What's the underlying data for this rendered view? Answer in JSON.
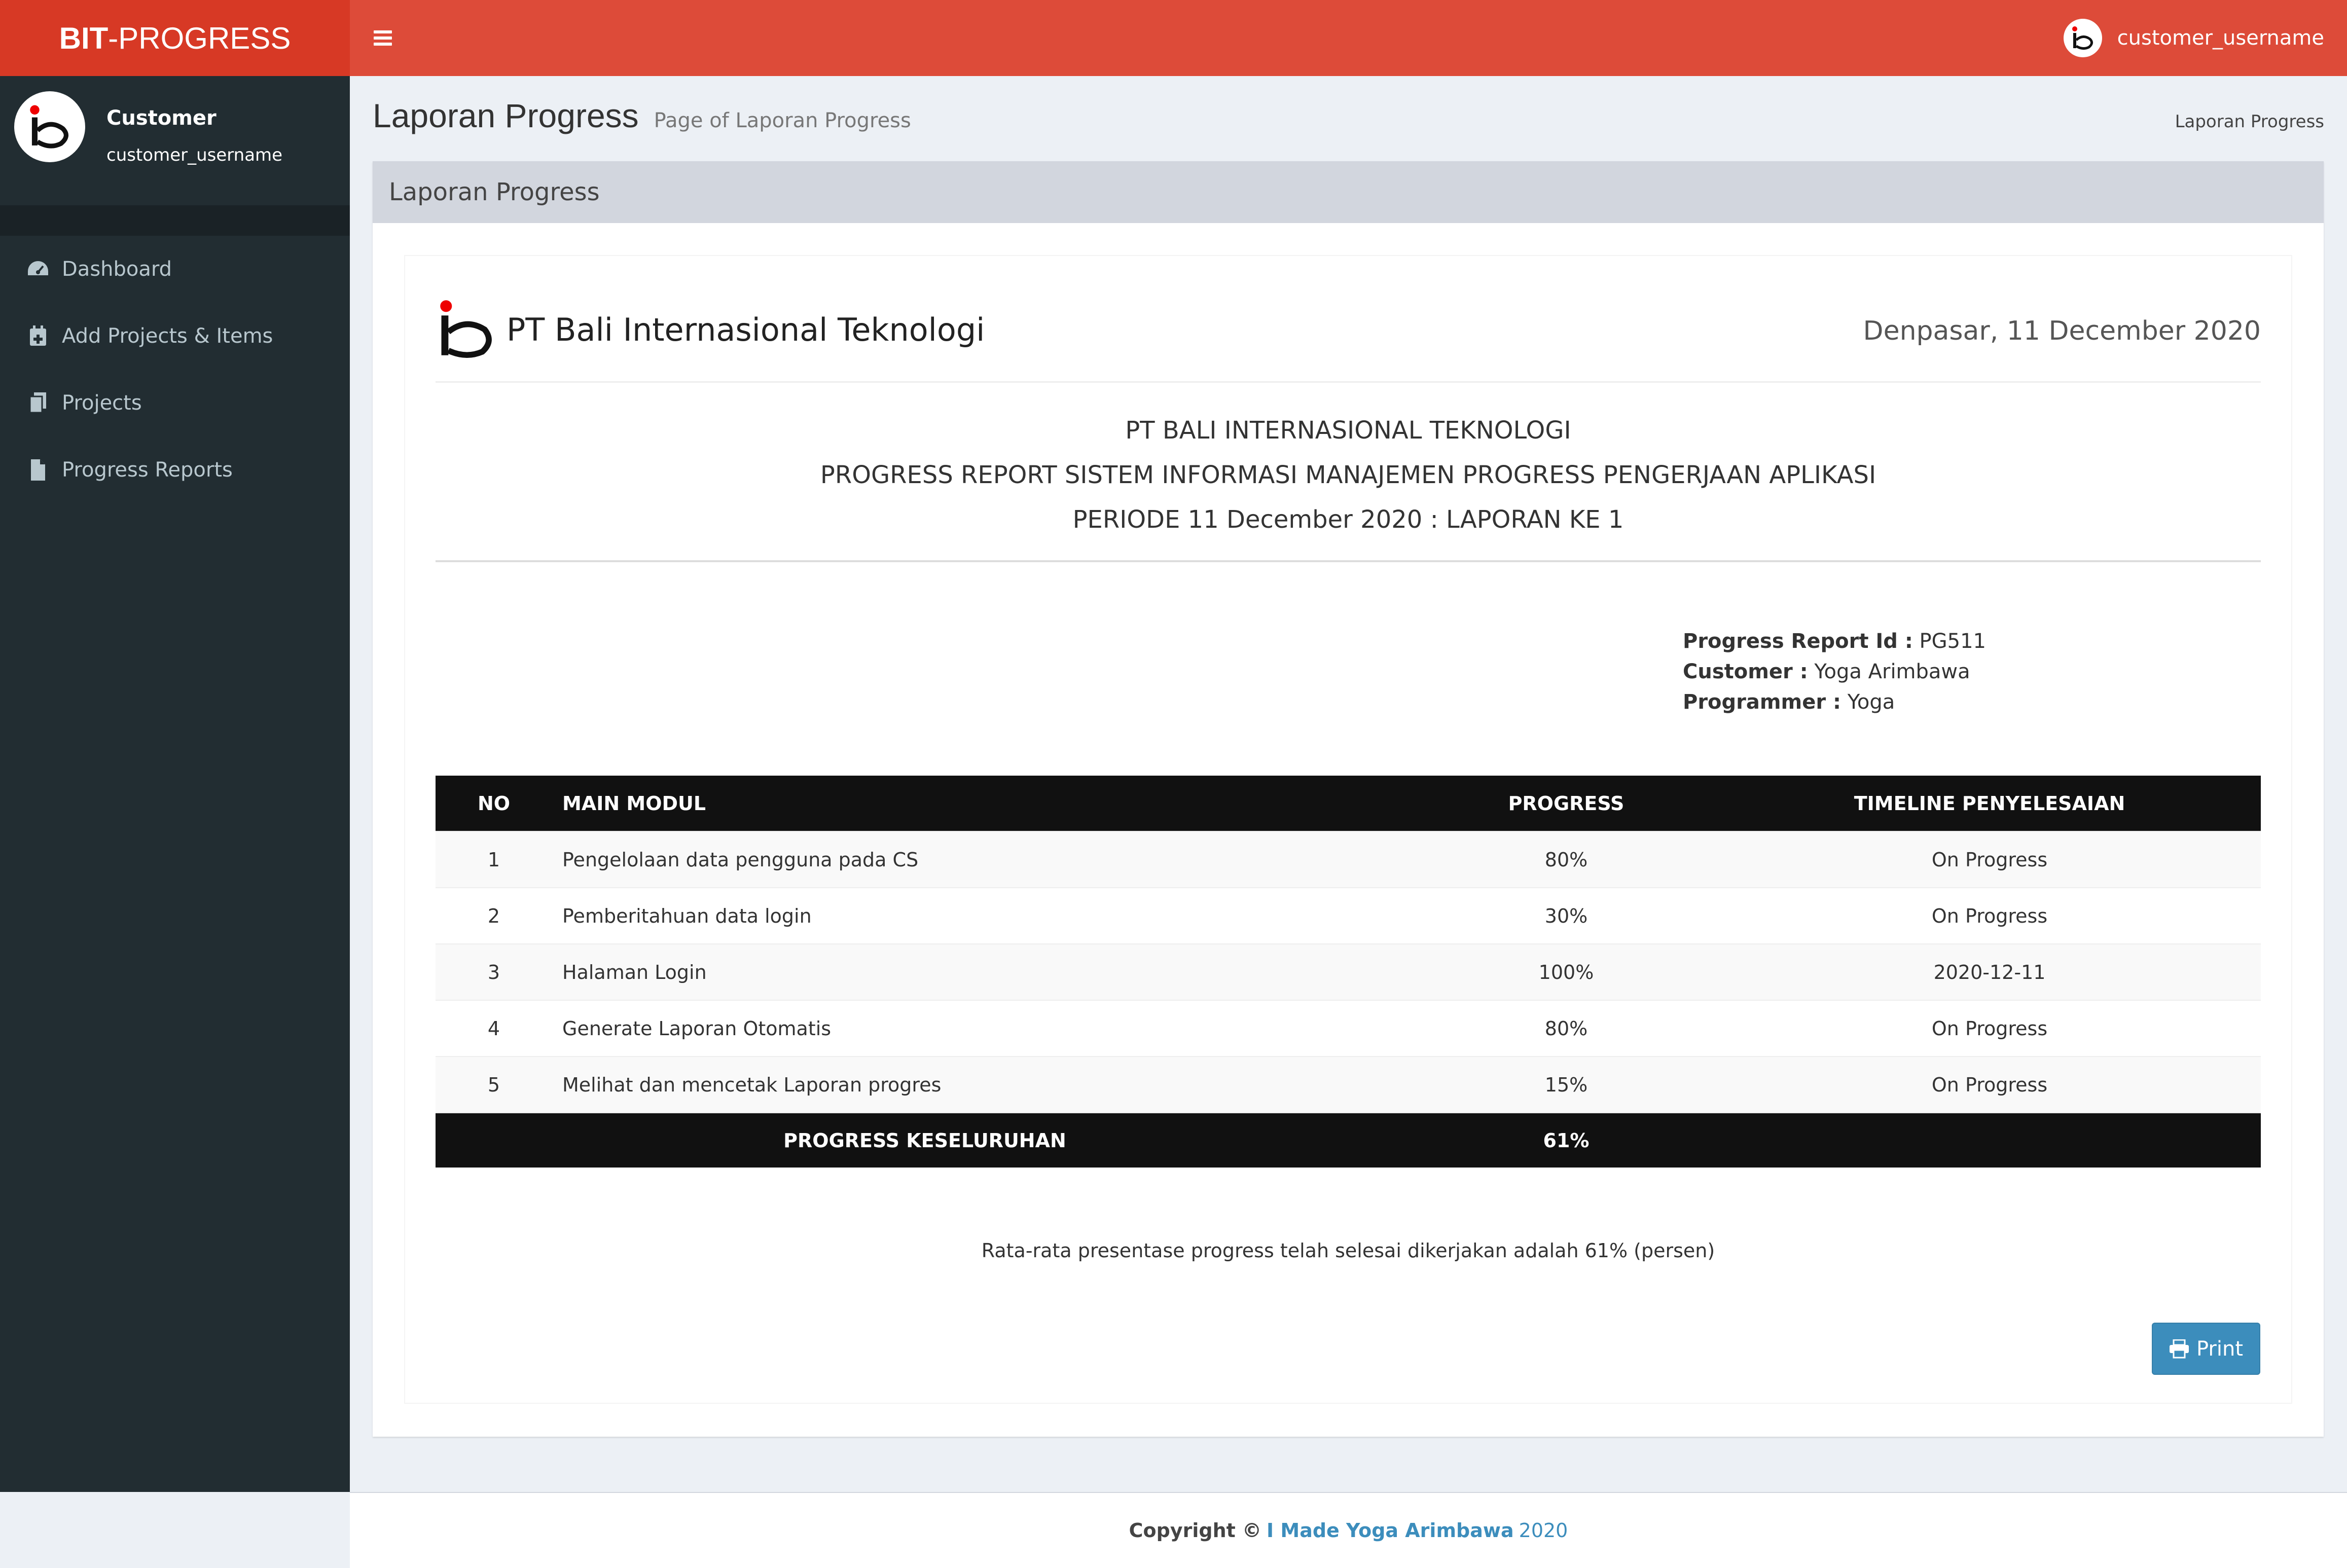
{
  "brand": {
    "bold": "BIT",
    "rest": "-PROGRESS"
  },
  "navbar": {
    "username": "customer_username"
  },
  "sidebar": {
    "role": "Customer",
    "username": "customer_username",
    "items": [
      {
        "label": "Dashboard",
        "icon": "dashboard-icon"
      },
      {
        "label": "Add Projects & Items",
        "icon": "calendar-plus-icon"
      },
      {
        "label": "Projects",
        "icon": "copy-icon"
      },
      {
        "label": "Progress Reports",
        "icon": "file-icon"
      }
    ]
  },
  "page": {
    "title": "Laporan Progress",
    "subtitle": "Page of Laporan Progress",
    "breadcrumb": "Laporan Progress",
    "box_title": "Laporan Progress"
  },
  "report": {
    "company": "PT Bali Internasional Teknologi",
    "date": "Denpasar, 11 December 2020",
    "heading1": "PT BALI INTERNASIONAL TEKNOLOGI",
    "heading2": "PROGRESS REPORT SISTEM INFORMASI MANAJEMEN PROGRESS PENGERJAAN APLIKASI",
    "heading3": "PERIODE 11 December 2020 : LAPORAN KE 1",
    "id_label": "Progress Report Id :",
    "id_value": "PG511",
    "customer_label": "Customer :",
    "customer_value": "Yoga Arimbawa",
    "programmer_label": "Programmer :",
    "programmer_value": "Yoga",
    "columns": [
      "NO",
      "MAIN MODUL",
      "PROGRESS",
      "TIMELINE PENYELESAIAN"
    ],
    "rows": [
      {
        "no": "1",
        "modul": "Pengelolaan data pengguna pada CS",
        "progress": "80%",
        "timeline": "On Progress"
      },
      {
        "no": "2",
        "modul": "Pemberitahuan data login",
        "progress": "30%",
        "timeline": "On Progress"
      },
      {
        "no": "3",
        "modul": "Halaman Login",
        "progress": "100%",
        "timeline": "2020-12-11"
      },
      {
        "no": "4",
        "modul": "Generate Laporan Otomatis",
        "progress": "80%",
        "timeline": "On Progress"
      },
      {
        "no": "5",
        "modul": "Melihat dan mencetak Laporan progres",
        "progress": "15%",
        "timeline": "On Progress"
      }
    ],
    "total_label": "PROGRESS KESELURUHAN",
    "total_value": "61%",
    "summary": "Rata-rata presentase progress telah selesai dikerjakan adalah 61% (persen)",
    "print_label": "Print"
  },
  "footer": {
    "copyright": "Copyright ©",
    "author": "I Made Yoga Arimbawa",
    "year": "2020"
  },
  "colors": {
    "header": "#dd4b39",
    "logo_bg": "#d73925",
    "sidebar": "#222d32",
    "accent": "#3c8dbc"
  }
}
